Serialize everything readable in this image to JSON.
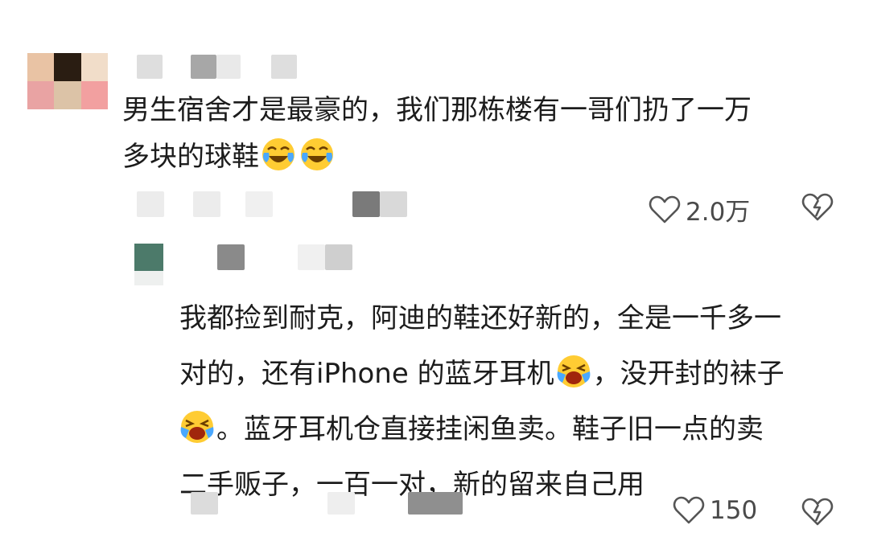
{
  "comment1": {
    "line1": "男生宿舍才是最豪的，我们那栋楼有一哥们扔了一万",
    "line2": "多块的球鞋",
    "emoji_names": [
      "crying-laughing-emoji",
      "crying-laughing-emoji"
    ],
    "likes": "2.0万"
  },
  "reply1": {
    "line1": "我都捡到耐克，阿迪的鞋还好新的，全是一千多一",
    "line2a": "对的，还有iPhone 的蓝牙耳机",
    "line2b": "，没开封的袜子",
    "line3": "。蓝牙耳机仓直接挂闲鱼卖。鞋子旧一点的卖",
    "line4": "二手贩子，一百一对，新的留来自己用",
    "emoji_names": [
      "bawling-emoji",
      "bawling-emoji"
    ],
    "likes": "150"
  },
  "icons": {
    "like": "heart-outline-icon",
    "dislike": "broken-heart-icon"
  }
}
